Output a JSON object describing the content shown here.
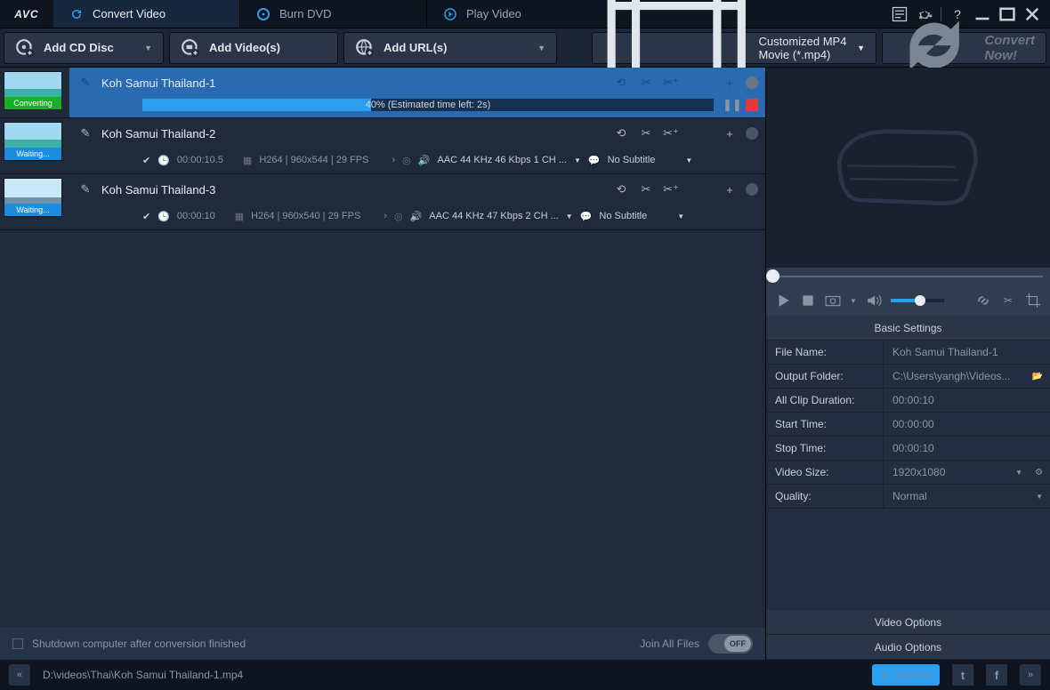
{
  "app": {
    "logo": "AVC"
  },
  "tabs": {
    "convert": "Convert Video",
    "burn": "Burn DVD",
    "play": "Play Video"
  },
  "toolbar": {
    "add_cd": "Add CD Disc",
    "add_videos": "Add Video(s)",
    "add_urls": "Add URL(s)",
    "profile": "Customized MP4 Movie (*.mp4)",
    "convert_now": "Convert Now!"
  },
  "files": [
    {
      "title": "Koh Samui Thailand-1",
      "status": "Converting",
      "progress_pct": 40,
      "progress_text": "40%  (Estimated time left: 2s)"
    },
    {
      "title": "Koh Samui Thailand-2",
      "status": "Waiting...",
      "duration": "00:00:10.5",
      "video_info": "H264 | 960x544 | 29 FPS",
      "audio_info": "AAC 44 KHz 46 Kbps 1 CH ...",
      "subtitle": "No Subtitle"
    },
    {
      "title": "Koh Samui Thailand-3",
      "status": "Waiting...",
      "duration": "00:00:10",
      "video_info": "H264 | 960x540 | 29 FPS",
      "audio_info": "AAC 44 KHz 47 Kbps 2 CH ...",
      "subtitle": "No Subtitle"
    }
  ],
  "listfoot": {
    "shutdown": "Shutdown computer after conversion finished",
    "joinall": "Join All Files",
    "switch": "OFF"
  },
  "settings": {
    "header_basic": "Basic Settings",
    "filename_lbl": "File Name:",
    "filename": "Koh Samui Thailand-1",
    "outfolder_lbl": "Output Folder:",
    "outfolder": "C:\\Users\\yangh\\Videos...",
    "clipdur_lbl": "All Clip Duration:",
    "clipdur": "00:00:10",
    "start_lbl": "Start Time:",
    "start": "00:00:00",
    "stop_lbl": "Stop Time:",
    "stop": "00:00:10",
    "vsize_lbl": "Video Size:",
    "vsize": "1920x1080",
    "quality_lbl": "Quality:",
    "quality": "Normal",
    "header_video": "Video Options",
    "header_audio": "Audio Options"
  },
  "status": {
    "path": "D:\\videos\\Thai\\Koh Samui Thailand-1.mp4",
    "upgrade": "Upgrade"
  }
}
